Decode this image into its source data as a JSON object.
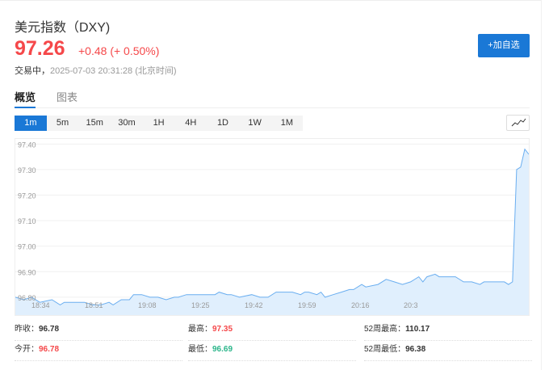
{
  "header": {
    "title": "美元指数（DXY)",
    "price": "97.26",
    "change": "+0.48 (+ 0.50%)",
    "status_label": "交易中，",
    "timestamp": "2025-07-03 20:31:28 (北京时间)",
    "add_button": "+加自选"
  },
  "tabs": [
    {
      "label": "概览",
      "active": true
    },
    {
      "label": "图表",
      "active": false
    }
  ],
  "intervals": [
    "1m",
    "5m",
    "15m",
    "30m",
    "1H",
    "4H",
    "1D",
    "1W",
    "1M"
  ],
  "active_interval": "1m",
  "chart_toggle_icon": "line-chart-icon",
  "colors": {
    "up": "#f5484a",
    "down": "#2bb58a",
    "accent": "#1a78d6",
    "line": "#6aaef0",
    "fill": "#e0effd"
  },
  "chart_data": {
    "type": "area",
    "ylim": [
      96.73,
      97.42
    ],
    "yticks": [
      "96.80",
      "96.90",
      "97.00",
      "97.10",
      "97.20",
      "97.30",
      "97.40"
    ],
    "xticks": [
      "18:34",
      "18:51",
      "19:08",
      "19:25",
      "19:42",
      "19:59",
      "20:16",
      "20:3"
    ],
    "xrange": [
      "18:28",
      "20:34"
    ],
    "grid": true,
    "points": [
      [
        "18:28",
        96.8
      ],
      [
        "18:30",
        96.79
      ],
      [
        "18:32",
        96.8
      ],
      [
        "18:34",
        96.78
      ],
      [
        "18:37",
        96.79
      ],
      [
        "18:39",
        96.77
      ],
      [
        "18:40",
        96.78
      ],
      [
        "18:42",
        96.78
      ],
      [
        "18:45",
        96.78
      ],
      [
        "18:47",
        96.77
      ],
      [
        "18:49",
        96.77
      ],
      [
        "18:51",
        96.78
      ],
      [
        "18:52",
        96.77
      ],
      [
        "18:54",
        96.79
      ],
      [
        "18:56",
        96.79
      ],
      [
        "18:57",
        96.81
      ],
      [
        "18:59",
        96.81
      ],
      [
        "19:01",
        96.8
      ],
      [
        "19:03",
        96.8
      ],
      [
        "19:05",
        96.79
      ],
      [
        "19:07",
        96.8
      ],
      [
        "19:08",
        96.8
      ],
      [
        "19:10",
        96.81
      ],
      [
        "19:13",
        96.81
      ],
      [
        "19:17",
        96.81
      ],
      [
        "19:18",
        96.82
      ],
      [
        "19:20",
        96.81
      ],
      [
        "19:21",
        96.81
      ],
      [
        "19:23",
        96.8
      ],
      [
        "19:26",
        96.81
      ],
      [
        "19:28",
        96.8
      ],
      [
        "19:30",
        96.8
      ],
      [
        "19:32",
        96.82
      ],
      [
        "19:34",
        96.82
      ],
      [
        "19:36",
        96.82
      ],
      [
        "19:38",
        96.81
      ],
      [
        "19:39",
        96.82
      ],
      [
        "19:40",
        96.82
      ],
      [
        "19:42",
        96.81
      ],
      [
        "19:43",
        96.82
      ],
      [
        "19:44",
        96.8
      ],
      [
        "19:46",
        96.81
      ],
      [
        "19:48",
        96.82
      ],
      [
        "19:50",
        96.83
      ],
      [
        "19:51",
        96.83
      ],
      [
        "19:53",
        96.85
      ],
      [
        "19:54",
        96.84
      ],
      [
        "19:57",
        96.85
      ],
      [
        "19:59",
        96.87
      ],
      [
        "20:01",
        96.86
      ],
      [
        "20:03",
        96.85
      ],
      [
        "20:05",
        96.86
      ],
      [
        "20:07",
        96.88
      ],
      [
        "20:08",
        96.86
      ],
      [
        "20:09",
        96.88
      ],
      [
        "20:11",
        96.89
      ],
      [
        "20:12",
        96.88
      ],
      [
        "20:15",
        96.88
      ],
      [
        "20:16",
        96.88
      ],
      [
        "20:18",
        96.86
      ],
      [
        "20:20",
        96.86
      ],
      [
        "20:22",
        96.85
      ],
      [
        "20:23",
        96.86
      ],
      [
        "20:26",
        96.86
      ],
      [
        "20:28",
        96.86
      ],
      [
        "20:29",
        96.85
      ],
      [
        "20:30",
        96.86
      ],
      [
        "20:31",
        97.3
      ],
      [
        "20:32",
        97.31
      ],
      [
        "20:33",
        97.38
      ],
      [
        "20:34",
        97.36
      ]
    ]
  },
  "stats": [
    {
      "label": "昨收：",
      "value": "96.78",
      "tone": ""
    },
    {
      "label": "最高：",
      "value": "97.35",
      "tone": "red"
    },
    {
      "label": "52周最高：",
      "value": "110.17",
      "tone": ""
    },
    {
      "label": "今开：",
      "value": "96.78",
      "tone": "red"
    },
    {
      "label": "最低：",
      "value": "96.69",
      "tone": "green"
    },
    {
      "label": "52周最低：",
      "value": "96.38",
      "tone": ""
    }
  ]
}
